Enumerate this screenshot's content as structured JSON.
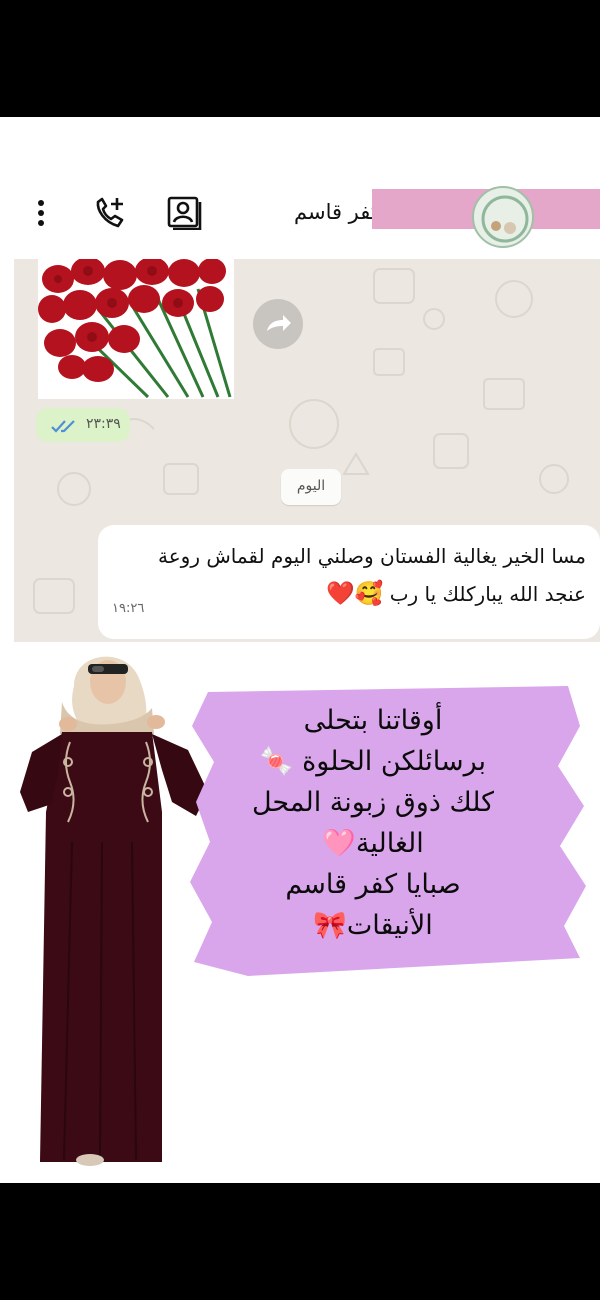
{
  "header": {
    "contact_name": "كفر قاسم"
  },
  "chat": {
    "sent_time": "٢٣:٣٩",
    "date_chip": "اليوم",
    "message": {
      "text": "مسا الخير يغالية الفستان وصلني اليوم لقماش روعة عنجد الله يباركلك يا رب",
      "emoji": "🥰❤️",
      "time": "١٩:٢٦"
    }
  },
  "promo": {
    "lines": [
      "أوقاتنا بتحلى",
      "برسائلكن الحلوة 🍬",
      "كلك ذوق زبونة المحل",
      "الغالية🩷",
      "صبايا كفر قاسم",
      "الأنيقات🎀"
    ]
  },
  "colors": {
    "chat_background": "#ece7e0",
    "sent_badge": "#dcf2c8",
    "redaction": "#e4a6c9",
    "brush": "#d9a6ec"
  },
  "icons": [
    "menu-icon",
    "add-call-icon",
    "contact-card-icon",
    "forward-icon",
    "double-check-icon"
  ]
}
